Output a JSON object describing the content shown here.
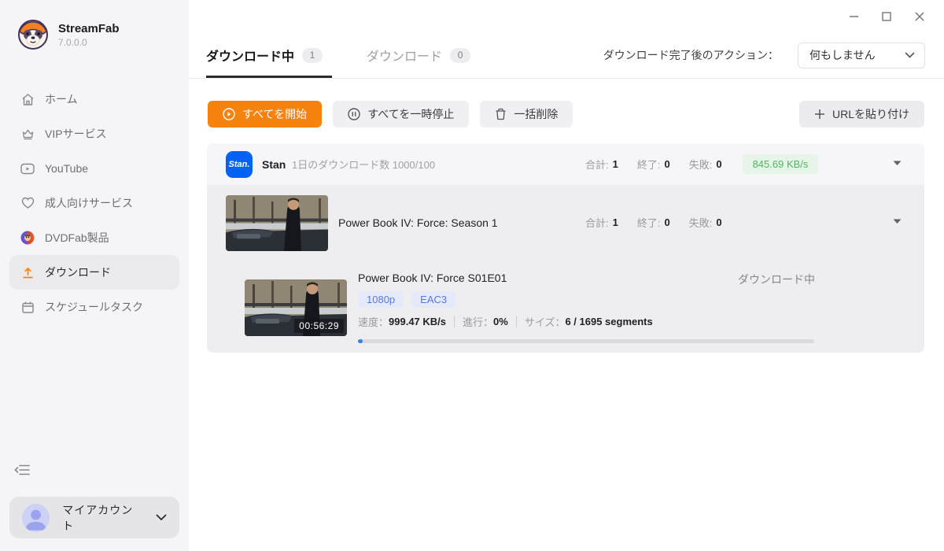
{
  "app": {
    "name": "StreamFab",
    "version": "7.0.0.0"
  },
  "window": {
    "controls": [
      "minimize",
      "maximize",
      "close"
    ]
  },
  "sidebar": {
    "items": [
      {
        "label": "ホーム",
        "icon": "home-icon"
      },
      {
        "label": "VIPサービス",
        "icon": "crown-icon"
      },
      {
        "label": "YouTube",
        "icon": "youtube-icon"
      },
      {
        "label": "成人向けサービス",
        "icon": "heart-icon"
      },
      {
        "label": "DVDFab製品",
        "icon": "dvdfab-icon"
      },
      {
        "label": "ダウンロード",
        "icon": "download-icon",
        "active": true
      },
      {
        "label": "スケジュールタスク",
        "icon": "calendar-icon"
      }
    ],
    "account": {
      "label": "マイアカウント"
    }
  },
  "header": {
    "tabs": [
      {
        "label": "ダウンロード中",
        "count": "1",
        "active": true
      },
      {
        "label": "ダウンロード",
        "count": "0",
        "active": false
      }
    ],
    "post_action_label": "ダウンロード完了後のアクション：",
    "post_action_value": "何もしません"
  },
  "toolbar": {
    "start_all": "すべてを開始",
    "pause_all": "すべてを一時停止",
    "bulk_delete": "一括削除",
    "paste_url": "URLを貼り付け"
  },
  "downloads": {
    "provider": {
      "badge_text": "Stan.",
      "name": "Stan",
      "daily_count": "1日のダウンロード数 1000/100",
      "stats": [
        {
          "label": "合計:",
          "value": "1"
        },
        {
          "label": "終了:",
          "value": "0"
        },
        {
          "label": "失敗:",
          "value": "0"
        }
      ],
      "speed": "845.69 KB/s"
    },
    "season": {
      "title": "Power Book IV: Force: Season 1",
      "stats": [
        {
          "label": "合計:",
          "value": "1"
        },
        {
          "label": "終了:",
          "value": "0"
        },
        {
          "label": "失敗:",
          "value": "0"
        }
      ]
    },
    "episode": {
      "title": "Power Book IV: Force S01E01",
      "duration": "00:56:29",
      "quality_badge": "1080p",
      "audio_badge": "EAC3",
      "speed_label": "速度：",
      "speed_value": "999.47 KB/s",
      "progress_label": "進行：",
      "progress_value": "0%",
      "size_label": "サイズ：",
      "size_value": "6 / 1695 segments",
      "status": "ダウンロード中",
      "progress_percent": 1
    }
  },
  "colors": {
    "accent_orange": "#f7820e",
    "stan_blue": "#0063f5",
    "speed_green": "#4fb763",
    "badge_blue": "#5a78d8",
    "progress_blue": "#3a80db"
  }
}
